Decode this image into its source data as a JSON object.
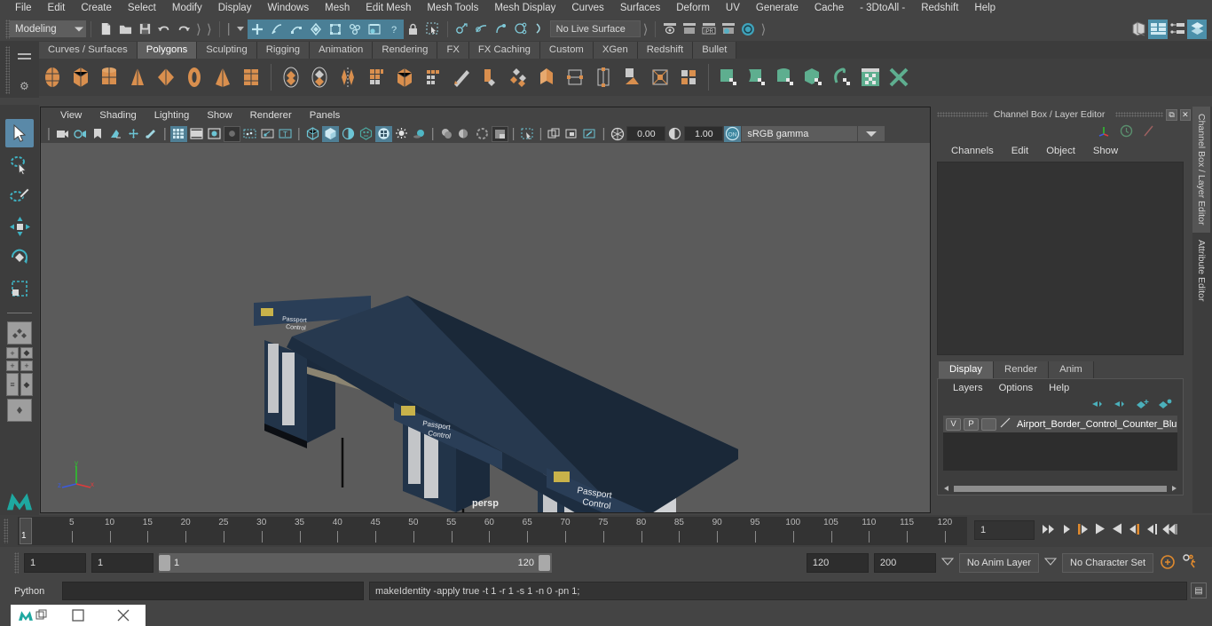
{
  "menubar": {
    "items": [
      "File",
      "Edit",
      "Create",
      "Select",
      "Modify",
      "Display",
      "Windows",
      "Mesh",
      "Edit Mesh",
      "Mesh Tools",
      "Mesh Display",
      "Curves",
      "Surfaces",
      "Deform",
      "UV",
      "Generate",
      "Cache",
      "- 3DtoAll -",
      "Redshift",
      "Help"
    ]
  },
  "statusline": {
    "mode": "Modeling",
    "live_surface": "No Live Surface",
    "icons": [
      "new-scene-icon",
      "open-scene-icon",
      "save-scene-icon",
      "undo-icon",
      "redo-icon",
      "select-by-hierarchy-icon",
      "select-by-object-icon",
      "select-by-component-icon",
      "mask-handle-icon",
      "mask-curve-icon",
      "mask-surface-icon",
      "mask-deformation-icon",
      "mask-dynamic-icon",
      "mask-rendering-icon",
      "mask-misc-icon",
      "lock-icon",
      "select-highlight-icon",
      "snap-grid-icon",
      "snap-curve-icon",
      "snap-point-icon",
      "snap-projected-icon",
      "snap-view-icon",
      "render-view-icon",
      "render-frame-icon",
      "ipr-render-icon",
      "render-settings-icon",
      "render-globals-icon",
      "hypershade-icon",
      "outliner-icon",
      "node-editor-icon",
      "attribute-editor-icon"
    ]
  },
  "shelf": {
    "tabs": [
      "Curves / Surfaces",
      "Polygons",
      "Sculpting",
      "Rigging",
      "Animation",
      "Rendering",
      "FX",
      "FX Caching",
      "Custom",
      "XGen",
      "Redshift",
      "Bullet"
    ],
    "active_tab": "Polygons",
    "primitives": [
      "polygon-sphere-icon",
      "polygon-cube-icon",
      "polygon-cylinder-icon",
      "polygon-cone-icon",
      "polygon-plane-icon",
      "polygon-torus-icon",
      "polygon-pyramid-icon",
      "polygon-prism-icon"
    ],
    "tools": [
      "combine-icon",
      "separate-icon",
      "mirror-icon",
      "smooth-icon",
      "boolean-icon",
      "multi-cut-icon",
      "bevel-icon",
      "extrude-icon",
      "bridge-icon",
      "append-icon",
      "target-weld-icon",
      "quad-draw-icon",
      "wedge-icon",
      "poke-icon"
    ],
    "uv_tools": [
      "uv-plane-icon",
      "uv-cylinder-icon",
      "uv-sphere-icon",
      "uv-automatic-icon",
      "uv-contour-icon",
      "uv-editor-icon",
      "uv-cut-icon"
    ]
  },
  "toolbox": {
    "items": [
      "select-tool",
      "lasso-select-tool",
      "paint-select-tool",
      "move-tool",
      "rotate-tool",
      "scale-tool",
      "last-tool",
      "single-pane-layout",
      "four-pane-layout",
      "outliner-persp-layout",
      "persp-graph-layout"
    ],
    "active": "select-tool"
  },
  "viewport": {
    "menus": [
      "View",
      "Shading",
      "Lighting",
      "Show",
      "Renderer",
      "Panels"
    ],
    "camera_label": "persp",
    "exposure": "0.00",
    "gamma": "1.00",
    "color_space": "sRGB gamma",
    "toolbar_icons": [
      "select-camera-icon",
      "lock-camera-icon",
      "bookmark-icon",
      "image-plane-icon",
      "resolution-gate-icon",
      "film-gate-icon",
      "grid-toggle-icon",
      "film-gate-toggle-icon",
      "shadow-toggle-icon",
      "gpu-cache-icon",
      "xray-icon",
      "xray-joints-icon",
      "texture-icon",
      "wireframe-icon",
      "smooth-shade-icon",
      "shade-wireframe-icon",
      "use-default-material-icon",
      "textured-icon",
      "lights-icon",
      "shadows-icon",
      "ao-icon",
      "motion-blur-icon",
      "multisample-icon",
      "isolate-select-icon",
      "snapshot-icon",
      "render-region-icon",
      "camera-attrs-icon",
      "exposure-icon",
      "contrast-icon",
      "view-transform-icon"
    ],
    "axis_labels": {
      "x": "x",
      "y": "y",
      "z": "z"
    },
    "scene_description": "Airport border control passport control counter - dark navy booths with roof canopy"
  },
  "right_panel": {
    "title": "Channel Box / Layer Editor",
    "window_buttons": [
      "undock-icon",
      "close-icon"
    ],
    "channel_menus": [
      "Channels",
      "Edit",
      "Object",
      "Show"
    ],
    "quick_icons": [
      "manipulator-icon",
      "clock-icon",
      "slash-icon"
    ],
    "layer_tabs": [
      "Display",
      "Render",
      "Anim"
    ],
    "active_layer_tab": "Display",
    "layer_menus": [
      "Layers",
      "Options",
      "Help"
    ],
    "layer_arrow_icons": [
      "move-layer-up-icon",
      "move-layer-down-icon",
      "new-layer-icon",
      "new-layer-from-selected-icon"
    ],
    "layers": [
      {
        "visibility": "V",
        "playback": "P",
        "color": "",
        "name": "Airport_Border_Control_Counter_Blu"
      }
    ]
  },
  "vertical_tabs": {
    "items": [
      "Channel Box / Layer Editor",
      "Attribute Editor"
    ],
    "active": "Channel Box / Layer Editor"
  },
  "timeline": {
    "ticks": [
      5,
      10,
      15,
      20,
      25,
      30,
      35,
      40,
      45,
      50,
      55,
      60,
      65,
      70,
      75,
      80,
      85,
      90,
      95,
      100,
      105,
      110,
      115,
      120
    ],
    "current_frame_marker": "1",
    "current_frame": "1",
    "playback_icons": [
      "go-to-start-icon",
      "step-back-keyframe-icon",
      "step-back-frame-icon",
      "play-backwards-icon",
      "play-forwards-icon",
      "step-forward-frame-icon",
      "step-forward-keyframe-icon",
      "go-to-end-icon"
    ]
  },
  "range_slider": {
    "anim_start": "1",
    "range_start": "1",
    "bar_start_label": "1",
    "bar_end_label": "120",
    "range_end": "120",
    "anim_end": "200",
    "anim_layer": "No Anim Layer",
    "character_set": "No Character Set",
    "right_icons": [
      "auto-key-icon",
      "animation-preferences-icon"
    ]
  },
  "command_line": {
    "language": "Python",
    "input_value": "",
    "status": "makeIdentity -apply true -t 1 -r 1 -s 1 -n 0 -pn 1;",
    "script_editor_icon": "script-editor-icon"
  },
  "taskbar": {
    "buttons": [
      "maya-app-icon",
      "restore-window-icon",
      "maximize-window-icon",
      "close-window-icon"
    ]
  },
  "colors": {
    "bg": "#444444",
    "panel": "#3f3f3f",
    "accent_blue": "#4f7f95",
    "shelf_orange": "#d98f4e",
    "uv_green": "#5eae8f",
    "model_navy": "#243a52"
  }
}
